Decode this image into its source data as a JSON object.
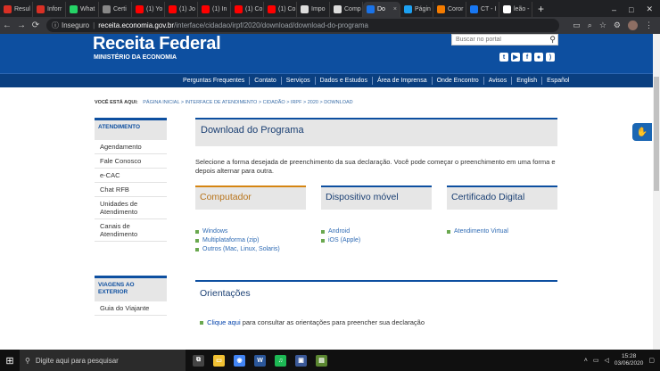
{
  "browser": {
    "tabs": [
      {
        "label": "Resul",
        "icon": "gmail-icon",
        "color": "#d93025"
      },
      {
        "label": "Inforr",
        "icon": "gmail-icon",
        "color": "#d93025"
      },
      {
        "label": "What",
        "icon": "whatsapp-icon",
        "color": "#25d366"
      },
      {
        "label": "Certi",
        "icon": "document-icon",
        "color": "#888888"
      },
      {
        "label": "(1) Yo",
        "icon": "youtube-icon",
        "color": "#ff0000"
      },
      {
        "label": "(1) Jo",
        "icon": "youtube-icon",
        "color": "#ff0000"
      },
      {
        "label": "(1) In",
        "icon": "youtube-icon",
        "color": "#ff0000"
      },
      {
        "label": "(1) Co",
        "icon": "youtube-icon",
        "color": "#ff0000"
      },
      {
        "label": "(1) Co",
        "icon": "youtube-icon",
        "color": "#ff0000"
      },
      {
        "label": "Impo",
        "icon": "wx-icon",
        "color": "#dddddd"
      },
      {
        "label": "Comp",
        "icon": "wx-icon",
        "color": "#dddddd"
      },
      {
        "label": "Do",
        "icon": "receita-icon",
        "color": "#1a73e8",
        "active": true
      },
      {
        "label": "Págin",
        "icon": "twitter-icon",
        "color": "#1da1f2"
      },
      {
        "label": "Coror",
        "icon": "orange-icon",
        "color": "#f57c00"
      },
      {
        "label": "CT - I",
        "icon": "facebook-icon",
        "color": "#1877f2"
      },
      {
        "label": "leão -",
        "icon": "google-icon",
        "color": "#ffffff"
      }
    ],
    "new_tab": "+",
    "window_controls": [
      "–",
      "□",
      "✕"
    ],
    "nav_buttons": [
      "←",
      "→",
      "⟳"
    ],
    "security_label": "Inseguro",
    "url_host": "receita.economia.gov.br",
    "url_path": "/interface/cidadao/irpf/2020/download/download-do-programa"
  },
  "site": {
    "logo": "Receita Federal",
    "ministry": "MINISTÉRIO DA ECONOMIA",
    "search_placeholder": "Buscar no portal",
    "social_icons": [
      "twitter-icon",
      "youtube-icon",
      "facebook-icon",
      "flickr-icon",
      "rss-icon"
    ],
    "nav": [
      "Perguntas Frequentes",
      "Contato",
      "Serviços",
      "Dados e Estudos",
      "Área de Imprensa",
      "Onde Encontro",
      "Avisos",
      "English",
      "Español"
    ],
    "accent_color": "#0d4fa0"
  },
  "breadcrumb": {
    "label": "VOCÊ ESTÁ AQUI:",
    "path": "PÁGINA INICIAL > INTERFACE DE ATENDIMENTO > CIDADÃO > IRPF > 2020 > DOWNLOAD"
  },
  "sidebar": {
    "sections": [
      {
        "title": "ATENDIMENTO",
        "items": [
          "Agendamento",
          "Fale Conosco",
          "e-CAC",
          "Chat RFB",
          "Unidades de Atendimento",
          "Canais de Atendimento"
        ]
      },
      {
        "title": "VIAGENS AO EXTERIOR",
        "items": [
          "Guia do Viajante"
        ]
      }
    ]
  },
  "main": {
    "title": "Download do Programa",
    "intro": "Selecione a forma desejada de preenchimento da sua declaração. Você pode começar o preenchimento em uma forma e depois alternar para outra.",
    "columns": [
      {
        "title": "Computador",
        "links": [
          "Windows",
          "Multiplataforma (zip)",
          "Outros (Mac, Linux, Solaris)"
        ]
      },
      {
        "title": "Dispositivo móvel",
        "links": [
          "Android",
          "iOS (Apple)"
        ]
      },
      {
        "title": "Certificado Digital",
        "links": [
          "Atendimento Virtual"
        ]
      }
    ],
    "orientations_title": "Orientações",
    "orientations_link": "Clique aqui",
    "orientations_text": " para consultar as orientações para preencher sua declaração"
  },
  "taskbar": {
    "search_placeholder": "Digite aqui para pesquisar",
    "apps": [
      {
        "name": "task-view-icon",
        "color": "#444444",
        "glyph": "⧉"
      },
      {
        "name": "explorer-icon",
        "color": "#f2c233",
        "glyph": "▭"
      },
      {
        "name": "chrome-icon",
        "color": "#4285f4",
        "glyph": "◉"
      },
      {
        "name": "word-icon",
        "color": "#2b579a",
        "glyph": "W"
      },
      {
        "name": "spotify-icon",
        "color": "#1db954",
        "glyph": "♫"
      },
      {
        "name": "app-icon",
        "color": "#3b5998",
        "glyph": "▣"
      },
      {
        "name": "minecraft-icon",
        "color": "#5b8731",
        "glyph": "▤"
      }
    ],
    "time": "15:28",
    "date": "03/06/2020"
  }
}
